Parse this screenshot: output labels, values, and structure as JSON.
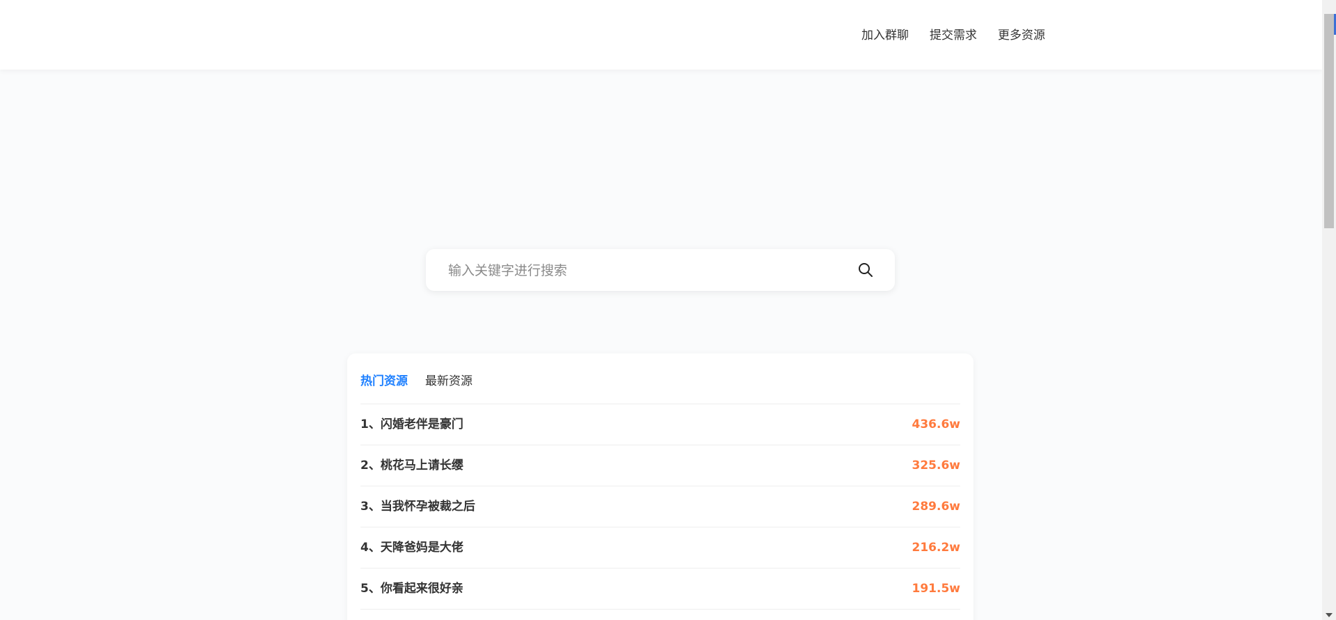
{
  "nav": {
    "items": [
      {
        "label": "加入群聊"
      },
      {
        "label": "提交需求"
      },
      {
        "label": "更多资源"
      }
    ]
  },
  "search": {
    "placeholder": "输入关键字进行搜索",
    "value": "",
    "icon": "search-icon"
  },
  "tabs": [
    {
      "label": "热门资源",
      "active": true
    },
    {
      "label": "最新资源",
      "active": false
    }
  ],
  "hot_list": [
    {
      "title": "1、闪婚老伴是豪门",
      "count": "436.6w"
    },
    {
      "title": "2、桃花马上请长缨",
      "count": "325.6w"
    },
    {
      "title": "3、当我怀孕被裁之后",
      "count": "289.6w"
    },
    {
      "title": "4、天降爸妈是大佬",
      "count": "216.2w"
    },
    {
      "title": "5、你看起来很好亲",
      "count": "191.5w"
    }
  ],
  "colors": {
    "accent": "#1e80ff",
    "count": "#ff7a3d",
    "text": "#333333"
  }
}
